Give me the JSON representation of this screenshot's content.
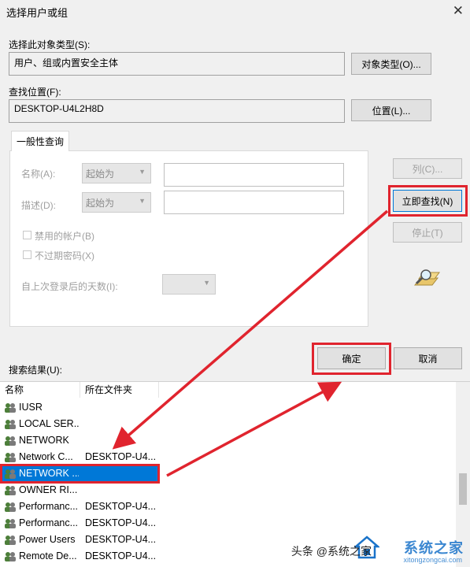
{
  "dialog": {
    "title": "选择用户或组",
    "close_glyph": "✕"
  },
  "object_type": {
    "label": "选择此对象类型(S):",
    "value": "用户、组或内置安全主体",
    "button": "对象类型(O)..."
  },
  "location": {
    "label": "查找位置(F):",
    "value": "DESKTOP-U4L2H8D",
    "button": "位置(L)..."
  },
  "query": {
    "tab_label": "一般性查询",
    "name_label": "名称(A):",
    "name_op": "起始为",
    "desc_label": "描述(D):",
    "desc_op": "起始为",
    "disabled_accounts": "禁用的帐户(B)",
    "non_expiring_pwd": "不过期密码(X)",
    "days_since_login": "自上次登录后的天数(I):",
    "columns_btn": "列(C)...",
    "find_now_btn": "立即查找(N)",
    "stop_btn": "停止(T)"
  },
  "actions": {
    "ok": "确定",
    "cancel": "取消"
  },
  "results": {
    "label": "搜索结果(U):",
    "col_name": "名称",
    "col_folder": "所在文件夹",
    "rows": [
      {
        "name": "IUSR",
        "folder": ""
      },
      {
        "name": "LOCAL SER...",
        "folder": ""
      },
      {
        "name": "NETWORK",
        "folder": ""
      },
      {
        "name": "Network C...",
        "folder": "DESKTOP-U4..."
      },
      {
        "name": "NETWORK ...",
        "folder": ""
      },
      {
        "name": "OWNER RI...",
        "folder": ""
      },
      {
        "name": "Performanc...",
        "folder": "DESKTOP-U4..."
      },
      {
        "name": "Performanc...",
        "folder": "DESKTOP-U4..."
      },
      {
        "name": "Power Users",
        "folder": "DESKTOP-U4..."
      },
      {
        "name": "Remote De...",
        "folder": "DESKTOP-U4..."
      }
    ],
    "selected_index": 4
  },
  "watermark": {
    "toutiao": "头条 @系统之家",
    "brand": "系统之家",
    "site": "xitongzongcai.com"
  },
  "colors": {
    "highlight": "#e0242e",
    "selection": "#0078d7"
  }
}
